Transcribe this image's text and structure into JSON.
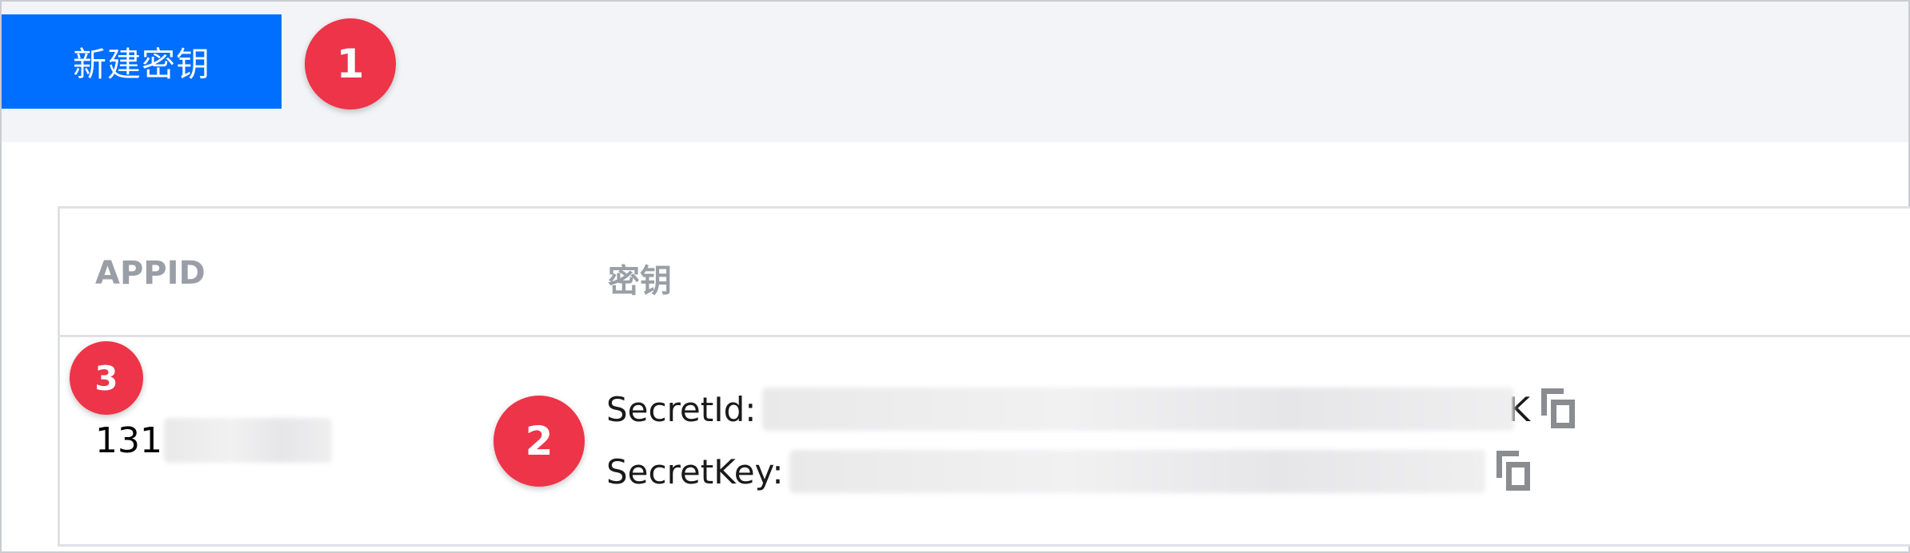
{
  "toolbar": {
    "new_key_label": "新建密钥"
  },
  "markers": {
    "m1": "1",
    "m2": "2",
    "m3": "3"
  },
  "table": {
    "headers": {
      "appid": "APPID",
      "key": "密钥"
    },
    "row": {
      "appid_visible": "131",
      "secret_id_label": "SecretId:",
      "secret_id_tail": "K",
      "secret_key_label": "SecretKey:"
    }
  },
  "colors": {
    "primary_button": "#006eff",
    "marker": "#ee3448",
    "toolbar_bg": "#f3f4f7",
    "header_text": "#9a9ea6"
  },
  "icons": {
    "copy": "copy-icon"
  }
}
